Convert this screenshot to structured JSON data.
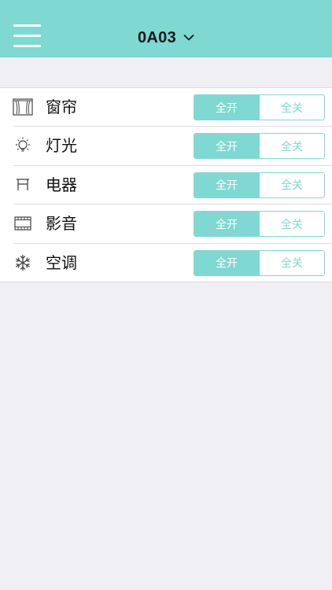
{
  "header": {
    "title": "0A03",
    "menu_icon": "hamburger-menu-icon",
    "dropdown_icon": "chevron-down-icon",
    "background": "#7fd8d2"
  },
  "rows": [
    {
      "label": "窗帘",
      "icon": "curtain-icon",
      "on_label": "全开",
      "off_label": "全关"
    },
    {
      "label": "灯光",
      "icon": "light-bulb-icon",
      "on_label": "全开",
      "off_label": "全关"
    },
    {
      "label": "电器",
      "icon": "appliance-icon",
      "on_label": "全开",
      "off_label": "全关"
    },
    {
      "label": "影音",
      "icon": "film-icon",
      "on_label": "全开",
      "off_label": "全关"
    },
    {
      "label": "空调",
      "icon": "snowflake-icon",
      "on_label": "全开",
      "off_label": "全关"
    }
  ],
  "colors": {
    "accent": "#7fd8d2",
    "page_background": "#efeff4",
    "list_background": "#ffffff"
  }
}
